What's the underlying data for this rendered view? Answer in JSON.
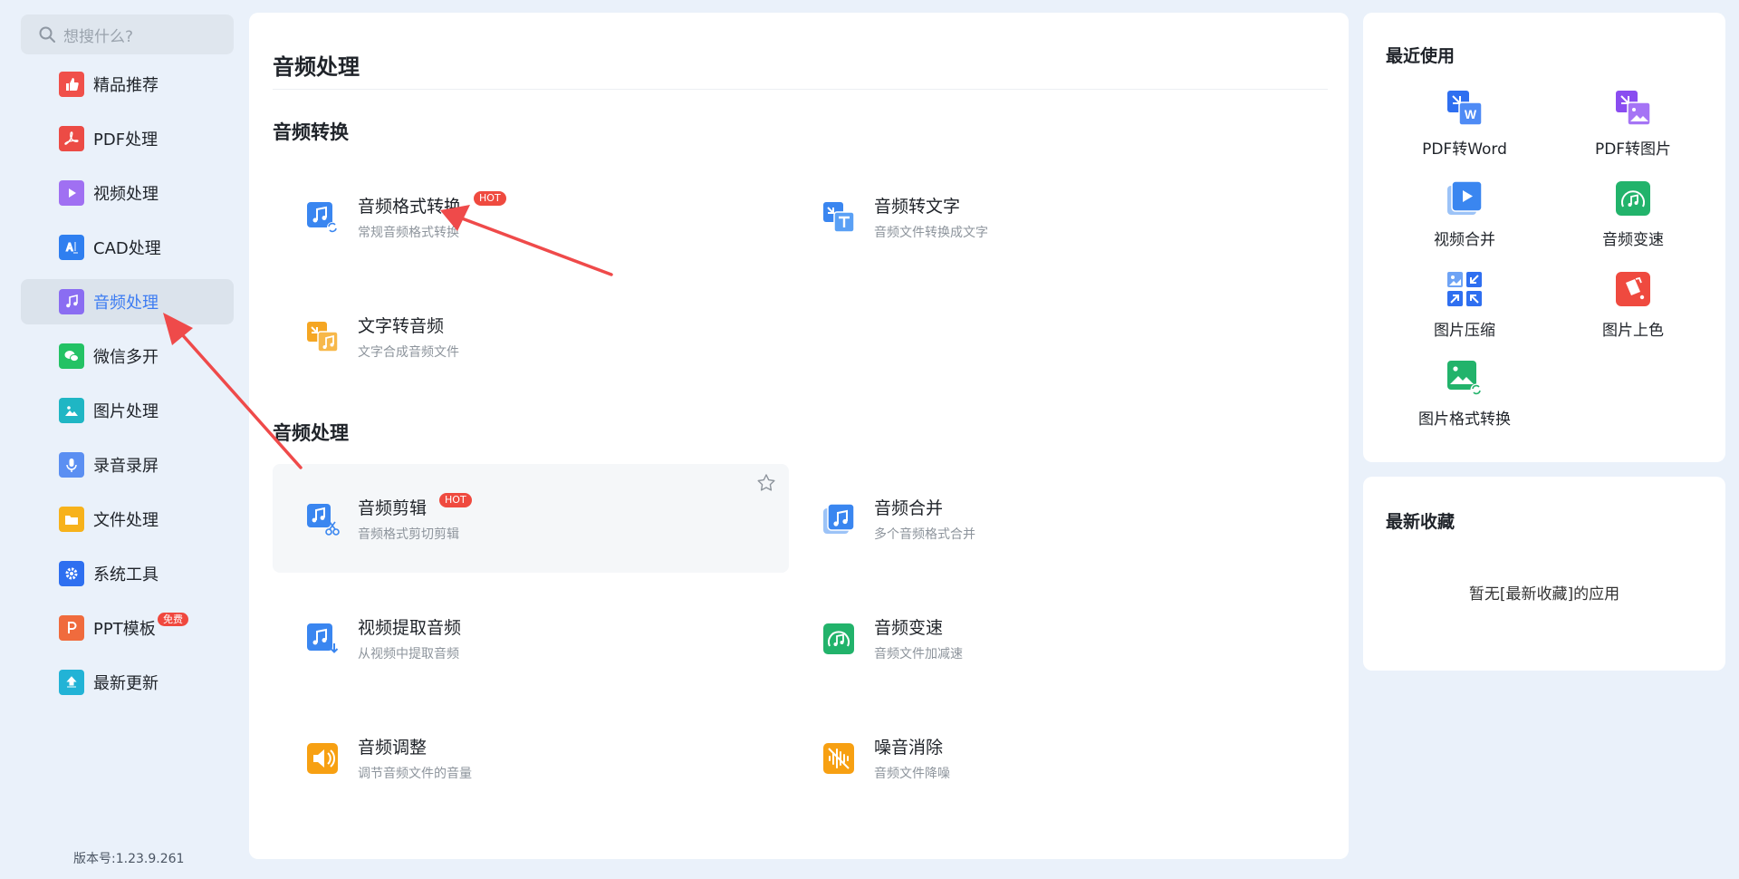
{
  "search": {
    "placeholder": "想搜什么?"
  },
  "sidebar": {
    "items": [
      {
        "label": "精品推荐",
        "icon": "thumbs-up-icon",
        "color": "#f0504a"
      },
      {
        "label": "PDF处理",
        "icon": "pdf-icon",
        "color": "#ec4b45"
      },
      {
        "label": "视频处理",
        "icon": "play-icon",
        "color": "#a070f2"
      },
      {
        "label": "CAD处理",
        "icon": "cad-icon",
        "color": "#2f7ff0"
      },
      {
        "label": "音频处理",
        "icon": "music-note-icon",
        "color": "#8a6df2"
      },
      {
        "label": "微信多开",
        "icon": "wechat-icon",
        "color": "#23c264"
      },
      {
        "label": "图片处理",
        "icon": "image-icon",
        "color": "#1fb6c4"
      },
      {
        "label": "录音录屏",
        "icon": "microphone-icon",
        "color": "#5b8ff2"
      },
      {
        "label": "文件处理",
        "icon": "folder-icon",
        "color": "#f7b21b"
      },
      {
        "label": "系统工具",
        "icon": "gear-icon",
        "color": "#2e6ff0"
      },
      {
        "label": "PPT模板",
        "icon": "ppt-icon",
        "color": "#f06b3d",
        "badge": "免费"
      },
      {
        "label": "最新更新",
        "icon": "upload-icon",
        "color": "#22b3d6"
      }
    ],
    "active_index": 4
  },
  "version": "版本号:1.23.9.261",
  "main": {
    "title": "音频处理",
    "sections": [
      {
        "title": "音频转换"
      },
      {
        "title": "音频处理"
      }
    ],
    "tools": [
      {
        "name": "音频格式转换",
        "desc": "常规音频格式转换",
        "badge": "HOT",
        "icon": "audio-convert-icon",
        "color": "#3a86f0"
      },
      {
        "name": "音频转文字",
        "desc": "音频文件转换成文字",
        "icon": "audio-to-text-icon",
        "color": "#3a86f0"
      },
      {
        "name": "文字转音频",
        "desc": "文字合成音频文件",
        "icon": "text-to-audio-icon",
        "color": "#f5a623"
      },
      {
        "name": "音频剪辑",
        "desc": "音频格式剪切剪辑",
        "badge": "HOT",
        "icon": "audio-cut-icon",
        "color": "#3a86f0"
      },
      {
        "name": "音频合并",
        "desc": "多个音频格式合并",
        "icon": "audio-merge-icon",
        "color": "#3a86f0"
      },
      {
        "name": "视频提取音频",
        "desc": "从视频中提取音频",
        "icon": "video-extract-audio-icon",
        "color": "#3a86f0"
      },
      {
        "name": "音频变速",
        "desc": "音频文件加减速",
        "icon": "audio-speed-icon",
        "color": "#22b36b"
      },
      {
        "name": "音频调整",
        "desc": "调节音频文件的音量",
        "icon": "volume-icon",
        "color": "#f7a012"
      },
      {
        "name": "噪音消除",
        "desc": "音频文件降噪",
        "icon": "noise-reduce-icon",
        "color": "#f7a012"
      }
    ]
  },
  "recent": {
    "title": "最近使用",
    "items": [
      {
        "label": "PDF转Word",
        "icon": "pdf-to-word-icon",
        "color": "#2f6ff0"
      },
      {
        "label": "PDF转图片",
        "icon": "pdf-to-image-icon",
        "color": "#8a4df0"
      },
      {
        "label": "视频合并",
        "icon": "video-merge-icon",
        "color": "#3a86f0"
      },
      {
        "label": "音频变速",
        "icon": "audio-speed-icon",
        "color": "#22b36b"
      },
      {
        "label": "图片压缩",
        "icon": "image-compress-icon",
        "color": "#2f6ff0"
      },
      {
        "label": "图片上色",
        "icon": "image-colorize-icon",
        "color": "#ef4a3f"
      },
      {
        "label": "图片格式转换",
        "icon": "image-format-icon",
        "color": "#22b36b"
      }
    ]
  },
  "favorites": {
    "title": "最新收藏",
    "empty_text": "暂无[最新收藏]的应用"
  }
}
